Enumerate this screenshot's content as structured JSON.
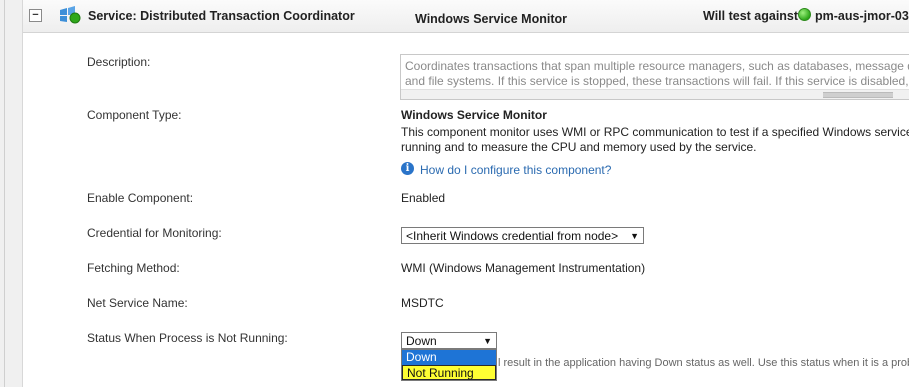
{
  "header": {
    "service_title": "Service: Distributed Transaction Coordinator",
    "monitor_title": "Windows Service Monitor",
    "test_against_label": "Will test against",
    "node_name": "pm-aus-jmor-03",
    "collapse_symbol": "−",
    "node_status_color": "#2fa81b"
  },
  "fields": {
    "description": {
      "label": "Description:",
      "value": "Coordinates transactions that span multiple resource managers, such as databases, message queues, and file systems. If this service is stopped, these transactions will fail. If this service is disabled, any services that explicitly depend on it will fail to start."
    },
    "component_type": {
      "label": "Component Type:",
      "title": "Windows Service Monitor",
      "description": "This component monitor uses WMI or RPC communication to test if a specified Windows service is running and to measure the CPU and memory used by the service.",
      "help_icon": "i",
      "help_link": "How do I configure this component?"
    },
    "enable_component": {
      "label": "Enable Component:",
      "value": "Enabled"
    },
    "credential": {
      "label": "Credential for Monitoring:",
      "selected": "<Inherit Windows credential from node>"
    },
    "fetching_method": {
      "label": "Fetching Method:",
      "value": "WMI (Windows Management Instrumentation)"
    },
    "net_service_name": {
      "label": "Net Service Name:",
      "value": "MSDTC"
    },
    "status_not_running": {
      "label": "Status When Process is Not Running:",
      "selected": "Down",
      "options": [
        "Down",
        "Not Running"
      ],
      "help_text": "l result in the application having Down status as well. Use this status when it is a problem"
    }
  },
  "icons": {
    "service": "windows-service-icon",
    "status": "status-up-icon",
    "info": "info-icon",
    "dropdown": "chevron-down-icon"
  },
  "colors": {
    "selected_option": "#1e74d6",
    "highlight_option": "#ffff33",
    "link": "#2a6ab0"
  }
}
